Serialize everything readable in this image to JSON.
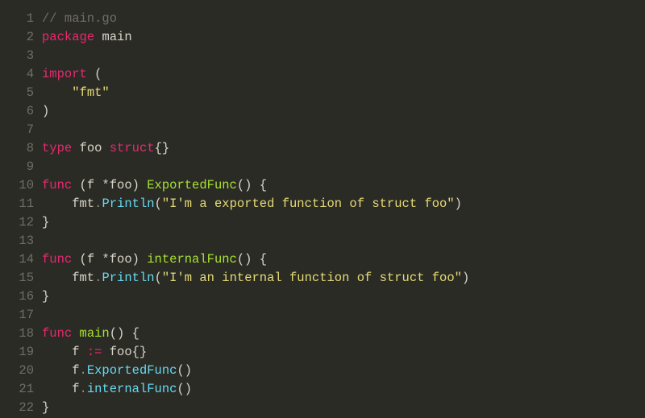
{
  "lines": [
    {
      "n": "1",
      "tokens": [
        [
          "comment",
          "// main.go"
        ]
      ]
    },
    {
      "n": "2",
      "tokens": [
        [
          "keyword",
          "package"
        ],
        [
          "punct",
          " "
        ],
        [
          "ident",
          "main"
        ]
      ]
    },
    {
      "n": "3",
      "tokens": []
    },
    {
      "n": "4",
      "tokens": [
        [
          "keyword",
          "import"
        ],
        [
          "punct",
          " ("
        ]
      ]
    },
    {
      "n": "5",
      "tokens": [
        [
          "punct",
          "    "
        ],
        [
          "string",
          "\"fmt\""
        ]
      ]
    },
    {
      "n": "6",
      "tokens": [
        [
          "punct",
          ")"
        ]
      ]
    },
    {
      "n": "7",
      "tokens": []
    },
    {
      "n": "8",
      "tokens": [
        [
          "keyword",
          "type"
        ],
        [
          "punct",
          " "
        ],
        [
          "ident",
          "foo"
        ],
        [
          "punct",
          " "
        ],
        [
          "keyword",
          "struct"
        ],
        [
          "punct",
          "{}"
        ]
      ]
    },
    {
      "n": "9",
      "tokens": []
    },
    {
      "n": "10",
      "tokens": [
        [
          "keyword",
          "func"
        ],
        [
          "punct",
          " (f *foo) "
        ],
        [
          "func",
          "ExportedFunc"
        ],
        [
          "punct",
          "() {"
        ]
      ]
    },
    {
      "n": "11",
      "tokens": [
        [
          "punct",
          "    fmt"
        ],
        [
          "dot",
          "."
        ],
        [
          "type",
          "Println"
        ],
        [
          "punct",
          "("
        ],
        [
          "string",
          "\"I'm a exported function of struct foo\""
        ],
        [
          "punct",
          ")"
        ]
      ]
    },
    {
      "n": "12",
      "tokens": [
        [
          "punct",
          "}"
        ]
      ]
    },
    {
      "n": "13",
      "tokens": []
    },
    {
      "n": "14",
      "tokens": [
        [
          "keyword",
          "func"
        ],
        [
          "punct",
          " (f *foo) "
        ],
        [
          "func",
          "internalFunc"
        ],
        [
          "punct",
          "() {"
        ]
      ]
    },
    {
      "n": "15",
      "tokens": [
        [
          "punct",
          "    fmt"
        ],
        [
          "dot",
          "."
        ],
        [
          "type",
          "Println"
        ],
        [
          "punct",
          "("
        ],
        [
          "string",
          "\"I'm an internal function of struct foo\""
        ],
        [
          "punct",
          ")"
        ]
      ]
    },
    {
      "n": "16",
      "tokens": [
        [
          "punct",
          "}"
        ]
      ]
    },
    {
      "n": "17",
      "tokens": []
    },
    {
      "n": "18",
      "tokens": [
        [
          "keyword",
          "func"
        ],
        [
          "punct",
          " "
        ],
        [
          "func",
          "main"
        ],
        [
          "punct",
          "() {"
        ]
      ]
    },
    {
      "n": "19",
      "tokens": [
        [
          "punct",
          "    f "
        ],
        [
          "keyword",
          ":="
        ],
        [
          "punct",
          " foo{}"
        ]
      ]
    },
    {
      "n": "20",
      "tokens": [
        [
          "punct",
          "    f"
        ],
        [
          "dot",
          "."
        ],
        [
          "type",
          "ExportedFunc"
        ],
        [
          "punct",
          "()"
        ]
      ]
    },
    {
      "n": "21",
      "tokens": [
        [
          "punct",
          "    f"
        ],
        [
          "dot",
          "."
        ],
        [
          "type",
          "internalFunc"
        ],
        [
          "punct",
          "()"
        ]
      ]
    },
    {
      "n": "22",
      "tokens": [
        [
          "punct",
          "}"
        ]
      ]
    }
  ]
}
